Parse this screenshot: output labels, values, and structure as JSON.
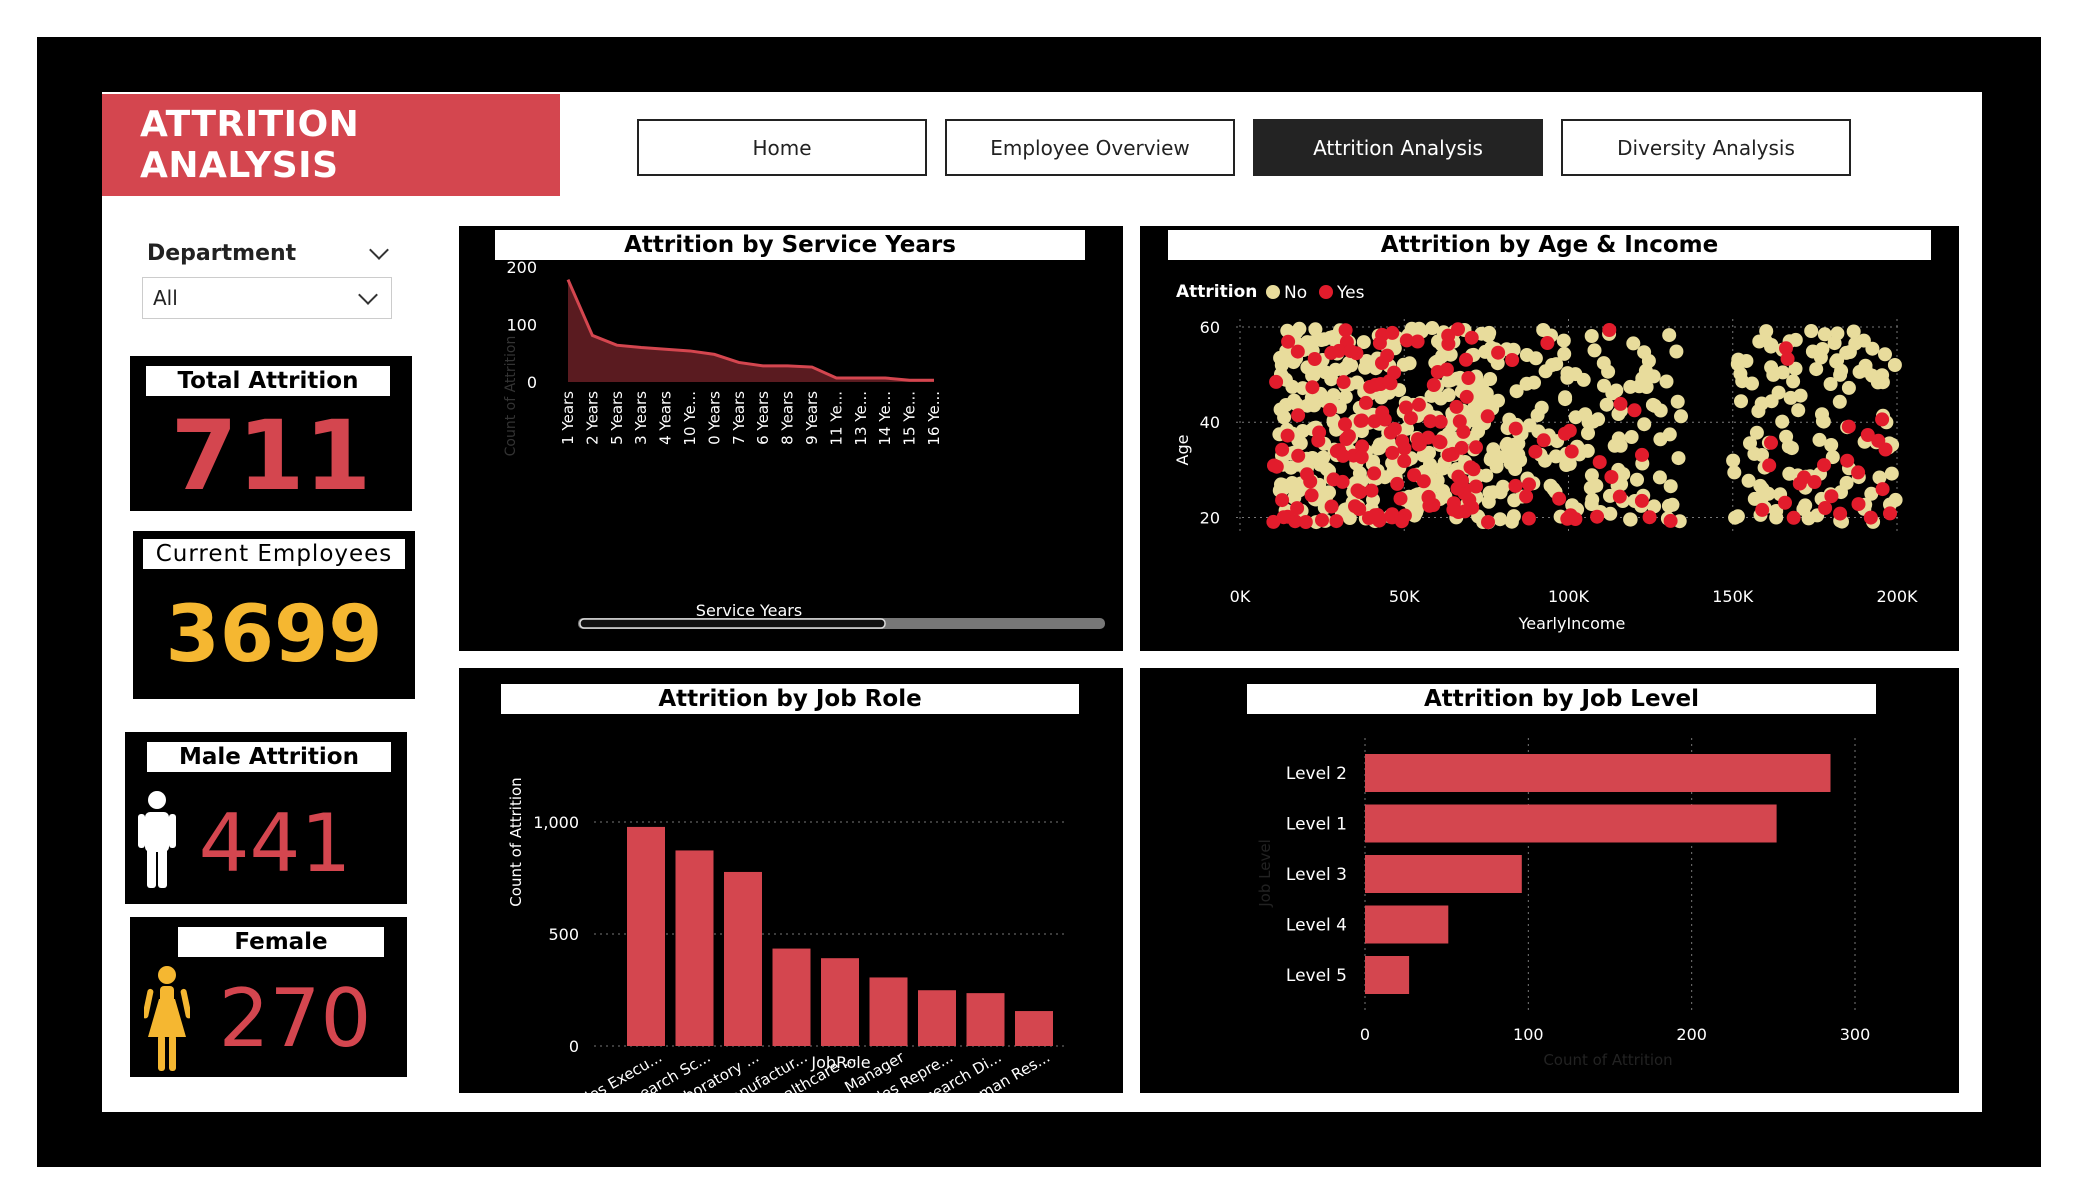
{
  "header": {
    "title": "ATTRITION ANALYSIS"
  },
  "nav": [
    {
      "label": "Home",
      "active": false
    },
    {
      "label": "Employee Overview",
      "active": false
    },
    {
      "label": "Attrition Analysis",
      "active": true
    },
    {
      "label": "Diversity Analysis",
      "active": false
    }
  ],
  "slicer": {
    "label": "Department",
    "value": "All"
  },
  "kpis": {
    "total_attrition": {
      "label": "Total Attrition",
      "value": "711"
    },
    "current_employees": {
      "label": "Current Employees",
      "value": "3699"
    },
    "male_attrition": {
      "label": "Male Attrition",
      "value": "441"
    },
    "female_attrition": {
      "label": "Female Attrition",
      "value": "270"
    }
  },
  "colors": {
    "accent_red": "#d4464f",
    "kpi_orange": "#f5b731",
    "scatter_no": "#e8dc9c",
    "scatter_yes": "#e21c2c",
    "area_fill": "#5a1b20"
  },
  "chart_data": [
    {
      "id": "service_years",
      "type": "area",
      "title": "Attrition by Service Years",
      "xlabel": "Service Years",
      "ylabel": "Count of Attrition",
      "ylim": [
        0,
        200
      ],
      "yticks": [
        "0",
        "100",
        "200"
      ],
      "categories": [
        "1 Years",
        "2 Years",
        "5 Years",
        "3 Years",
        "4 Years",
        "10 Ye...",
        "0 Years",
        "7 Years",
        "6 Years",
        "8 Years",
        "9 Years",
        "11 Ye...",
        "13 Ye...",
        "14 Ye...",
        "15 Ye...",
        "16 Ye..."
      ],
      "values": [
        178,
        81,
        64,
        60,
        57,
        54,
        48,
        34,
        28,
        28,
        26,
        7,
        7,
        7,
        3,
        3
      ],
      "scrollbar": true
    },
    {
      "id": "age_income",
      "type": "scatter",
      "title": "Attrition by Age & Income",
      "legend_title": "Attrition",
      "legend_position": "top-left",
      "series_names": [
        "No",
        "Yes"
      ],
      "xlabel": "YearlyIncome",
      "ylabel": "Age",
      "xlim": [
        0,
        200000
      ],
      "ylim": [
        18,
        60
      ],
      "xticks": [
        "0K",
        "50K",
        "100K",
        "150K",
        "200K"
      ],
      "yticks": [
        "20",
        "40",
        "60"
      ]
    },
    {
      "id": "job_role",
      "type": "bar",
      "title": "Attrition by Job Role",
      "xlabel": "JobRole",
      "ylabel": "Count of Attrition",
      "ylim": [
        0,
        1000
      ],
      "yticks": [
        "0",
        "500",
        "1,000"
      ],
      "categories": [
        "Sales Execu...",
        "Research Sc...",
        "Laboratory ...",
        "Manufactur...",
        "Healthcare ...",
        "Manager",
        "Sales Repre...",
        "Research Di...",
        "Human Res..."
      ],
      "values": [
        978,
        873,
        777,
        435,
        392,
        306,
        249,
        236,
        156
      ]
    },
    {
      "id": "job_level",
      "type": "bar",
      "orientation": "horizontal",
      "title": "Attrition by Job Level",
      "xlabel": "Count of Attrition",
      "ylabel": "Job Level",
      "xlim": [
        0,
        300
      ],
      "xticks": [
        "0",
        "100",
        "200",
        "300"
      ],
      "categories": [
        "Level 2",
        "Level 1",
        "Level 3",
        "Level 4",
        "Level 5"
      ],
      "values": [
        285,
        252,
        96,
        51,
        27
      ]
    }
  ]
}
